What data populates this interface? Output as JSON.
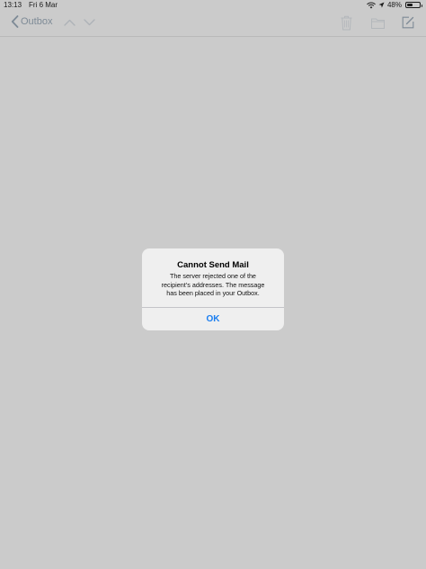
{
  "status_bar": {
    "time": "13:13",
    "date": "Fri 6 Mar",
    "battery_percent": "48%",
    "battery_level": 0.48,
    "icons": [
      "wifi-icon",
      "location-icon",
      "battery-icon"
    ]
  },
  "nav": {
    "back_label": "Outbox",
    "icons": [
      "chevron-left-icon",
      "chevron-up-icon",
      "chevron-down-icon",
      "trash-icon",
      "folder-icon",
      "compose-icon"
    ]
  },
  "alert": {
    "title": "Cannot Send Mail",
    "message_lines": [
      "The server rejected one of the",
      "recipient’s addresses.  The message",
      "has been placed in your Outbox."
    ],
    "ok_label": "OK"
  },
  "colors": {
    "background": "#cbcbcb",
    "alert_background": "#efefef",
    "accent": "#1a7ef0",
    "nav_tint": "#7d8a96"
  }
}
